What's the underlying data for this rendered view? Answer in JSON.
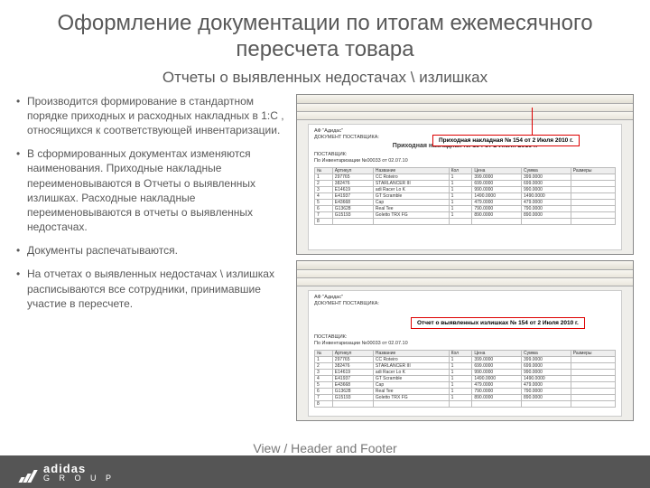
{
  "title": "Оформление документации по итогам ежемесячного пересчета товара",
  "subtitle": "Отчеты о выявленных недостачах \\ излишках",
  "bullets": [
    "Производится формирование в стандартном порядке приходных и расходных накладных в 1:С , относящихся к соответствующей инвентаризации.",
    "В сформированных документах изменяются наименования.  Приходные накладные переименовываются в Отчеты о выявленных излишках. Расходные накладные переименовываются в отчеты о выявленных недостачах.",
    "Документы распечатываются.",
    "На отчетах о выявленных недостачах \\ излишках  расписываются все сотрудники, принимавшие участие в пересчете."
  ],
  "screenshot1": {
    "callout": "Приходная накладная № 154 от 2 Июля 2010 г.",
    "company": "АФ \"Адидас\"",
    "docline": "ДОКУМЕНТ ПОСТАВЩИКА:",
    "supplier": "ПОСТАВЩИК:",
    "inv": "По Инвентаризации №00033 от 02.07.10",
    "docTitle": "Приходная накладная № 154 от 2 Июля 2010 г.",
    "cols": [
      "№",
      "Артикул",
      "Название",
      "Кол",
      "Цена",
      "Сумма",
      "Размеры"
    ],
    "rows": [
      [
        "1",
        "297765",
        "CC Roteiro",
        "1",
        "399.0000",
        "399.0000",
        ""
      ],
      [
        "2",
        "382476",
        "STARLANCER III",
        "1",
        "699.0000",
        "699.0000",
        ""
      ],
      [
        "3",
        "E14619",
        "adi Racer Lo K",
        "1",
        "990.0000",
        "990.0000",
        ""
      ],
      [
        "4",
        "E41937",
        "GT Scramble",
        "1",
        "1490.0000",
        "1490.0000",
        ""
      ],
      [
        "5",
        "E43668",
        "Cap",
        "1",
        "479.0000",
        "479.0000",
        ""
      ],
      [
        "6",
        "G13628",
        "Real Tee",
        "1",
        "790.0000",
        "790.0000",
        ""
      ],
      [
        "7",
        "G15193",
        "Goletto TRX FG",
        "1",
        "890.0000",
        "890.0000",
        ""
      ],
      [
        "8",
        "",
        "",
        "",
        "",
        "",
        ""
      ]
    ]
  },
  "screenshot2": {
    "callout": "Отчет о выявленных излишках № 154 от 2 Июля 2010 г.",
    "company": "АФ \"Адидас\"",
    "docline": "ДОКУМЕНТ ПОСТАВЩИКА:",
    "supplier": "ПОСТАВЩИК:",
    "inv": "По Инвентаризации №00033 от 02.07.10",
    "cols": [
      "№",
      "Артикул",
      "Название",
      "Кол",
      "Цена",
      "Сумма",
      "Размеры"
    ],
    "rows": [
      [
        "1",
        "297765",
        "CC Roteiro",
        "1",
        "399.0000",
        "399.0000",
        ""
      ],
      [
        "2",
        "382476",
        "STARLANCER III",
        "1",
        "699.0000",
        "699.0000",
        ""
      ],
      [
        "3",
        "E14619",
        "adi Racer Lo K",
        "1",
        "990.0000",
        "990.0000",
        ""
      ],
      [
        "4",
        "E41937",
        "GT Scramble",
        "1",
        "1490.0000",
        "1490.0000",
        ""
      ],
      [
        "5",
        "E43668",
        "Cap",
        "1",
        "479.0000",
        "479.0000",
        ""
      ],
      [
        "6",
        "G13628",
        "Real Tee",
        "1",
        "790.0000",
        "790.0000",
        ""
      ],
      [
        "7",
        "G15193",
        "Goletto TRX FG",
        "1",
        "890.0000",
        "890.0000",
        ""
      ],
      [
        "8",
        "",
        "",
        "",
        "",
        "",
        ""
      ]
    ]
  },
  "footer": {
    "hint": "View / Header and Footer",
    "brand": "adidas",
    "group": "G R O U P"
  }
}
